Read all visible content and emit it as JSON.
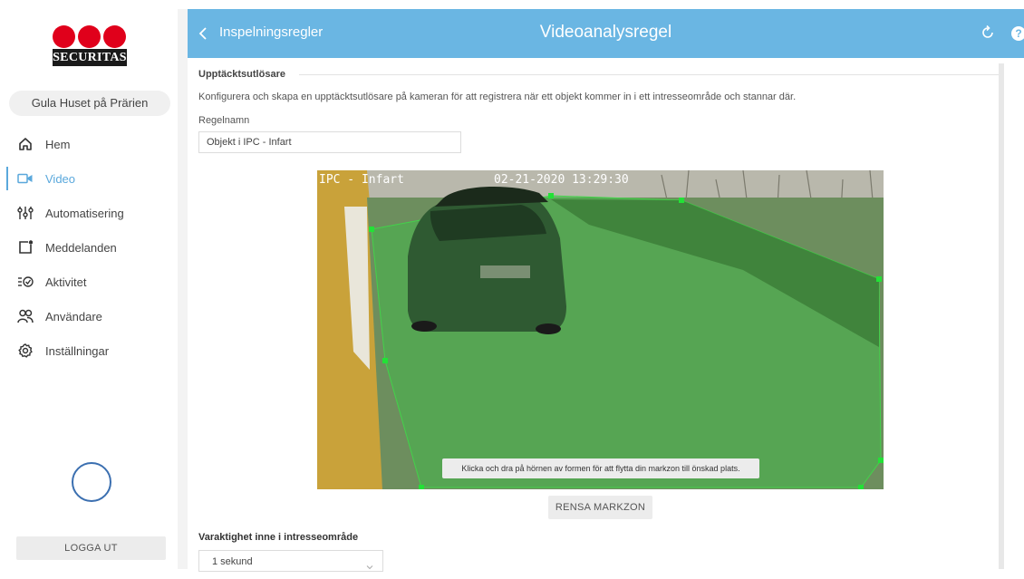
{
  "brand": {
    "logo_text": "SECURITAS",
    "logo_red": "#e0001b",
    "accent": "#6ab6e3"
  },
  "sidebar": {
    "site_name": "Gula Huset på Prärien",
    "items": [
      {
        "label": "Hem",
        "icon": "home-icon"
      },
      {
        "label": "Video",
        "icon": "video-camera-icon",
        "active": true
      },
      {
        "label": "Automatisering",
        "icon": "sliders-icon"
      },
      {
        "label": "Meddelanden",
        "icon": "message-icon"
      },
      {
        "label": "Aktivitet",
        "icon": "activity-icon"
      },
      {
        "label": "Användare",
        "icon": "users-icon"
      },
      {
        "label": "Inställningar",
        "icon": "settings-icon"
      }
    ],
    "logout_label": "LOGGA UT"
  },
  "header": {
    "back_label": "Inspelningsregler",
    "title": "Videoanalysregel",
    "refresh_icon": "refresh-icon",
    "help_icon": "help-icon",
    "help_glyph": "?"
  },
  "content": {
    "section_title": "Upptäcktsutlösare",
    "description": "Konfigurera och skapa en upptäcktsutlösare på kameran för att registrera när ett objekt kommer in i ett intresseområde och stannar där.",
    "rule_name_label": "Regelnamn",
    "rule_name_value": "Objekt i IPC - Infart",
    "camera_overlay": "IPC - Infart",
    "camera_timestamp": "02-21-2020 13:29:30",
    "zone_hint": "Klicka och dra på hörnen av formen för att flytta din markzon till önskad plats.",
    "clear_zone_label": "RENSA MARKZON",
    "duration_label": "Varaktighet inne i intresseområde",
    "duration_value": "1 sekund"
  }
}
